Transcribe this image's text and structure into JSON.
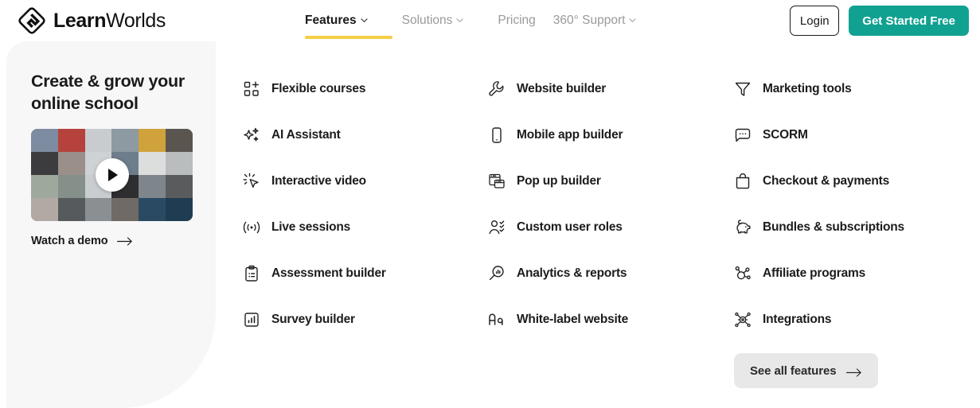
{
  "brand": {
    "name_bold": "Learn",
    "name_light": "Worlds",
    "logo_icon": "learnworlds-logo-icon"
  },
  "nav": {
    "items": [
      {
        "label": "Features",
        "has_chevron": true,
        "active": true
      },
      {
        "label": "Solutions",
        "has_chevron": true,
        "active": false
      },
      {
        "label": "Pricing",
        "has_chevron": false,
        "active": false
      },
      {
        "label": "360° Support",
        "has_chevron": true,
        "active": false
      }
    ]
  },
  "actions": {
    "login_label": "Login",
    "cta_label": "Get Started Free"
  },
  "promo": {
    "title": "Create & grow your online school",
    "video_play_icon": "play-icon",
    "watch_label": "Watch a demo",
    "watch_arrow_icon": "arrow-right-icon"
  },
  "mega_menu": {
    "columns": [
      {
        "items": [
          {
            "label": "Flexible courses",
            "icon": "grid-plus-icon"
          },
          {
            "label": "AI Assistant",
            "icon": "sparkles-icon"
          },
          {
            "label": "Interactive video",
            "icon": "cursor-click-icon"
          },
          {
            "label": "Live sessions",
            "icon": "broadcast-icon"
          },
          {
            "label": "Assessment builder",
            "icon": "clipboard-list-icon"
          },
          {
            "label": "Survey builder",
            "icon": "bar-chart-box-icon"
          }
        ]
      },
      {
        "items": [
          {
            "label": "Website builder",
            "icon": "wrench-icon"
          },
          {
            "label": "Mobile app builder",
            "icon": "mobile-phone-icon"
          },
          {
            "label": "Pop up builder",
            "icon": "popup-window-icon"
          },
          {
            "label": "Custom user roles",
            "icon": "user-check-icon"
          },
          {
            "label": "Analytics & reports",
            "icon": "magnifier-chart-icon"
          },
          {
            "label": "White-label website",
            "icon": "typography-aa-icon"
          }
        ]
      },
      {
        "items": [
          {
            "label": "Marketing tools",
            "icon": "funnel-icon"
          },
          {
            "label": "SCORM",
            "icon": "speech-bubble-icon"
          },
          {
            "label": "Checkout & payments",
            "icon": "shopping-bag-icon"
          },
          {
            "label": "Bundles & subscriptions",
            "icon": "piggy-bank-icon"
          },
          {
            "label": "Affiliate programs",
            "icon": "affiliate-nodes-icon"
          },
          {
            "label": "Integrations",
            "icon": "integrations-nodes-icon"
          }
        ]
      }
    ],
    "see_all_label": "See all features",
    "see_all_arrow_icon": "arrow-right-icon"
  },
  "colors": {
    "accent_yellow": "#f5cf47",
    "cta_teal": "#11a191",
    "panel_gray": "#f7f7f8",
    "button_gray": "#e8e8e8",
    "text_dark": "#1c1c1c",
    "text_muted": "#9a9a9a"
  }
}
